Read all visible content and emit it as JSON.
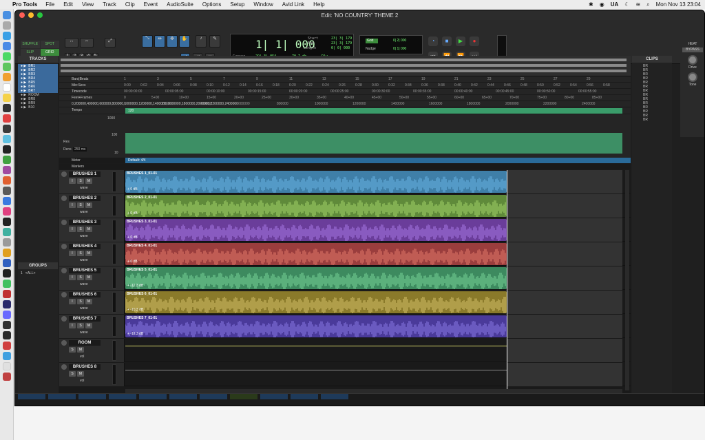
{
  "menubar": {
    "app_name": "Pro Tools",
    "items": [
      "File",
      "Edit",
      "View",
      "Track",
      "Clip",
      "Event",
      "AudioSuite",
      "Options",
      "Setup",
      "Window",
      "Avid Link",
      "Help"
    ],
    "right_text": "UA",
    "datetime": "Mon Nov 13  23:04"
  },
  "window": {
    "title": "Edit: 'NO COUNTRY' THEME 2"
  },
  "toolbar": {
    "modes": [
      "SHUFFLE",
      "SPOT",
      "SLIP",
      "GRID"
    ],
    "active_mode": "GRID",
    "zoom_presets": [
      "1",
      "2",
      "3",
      "4",
      "5"
    ]
  },
  "counter": {
    "main": "1| 1| 000",
    "start_label": "Start",
    "end_label": "End",
    "length_label": "Length",
    "start_value": "23| 3| 179",
    "end_value": "23| 3| 179",
    "length_value": "0| 0| 000",
    "cursor_label": "Cursor",
    "cursor_value": "29| 3| 054",
    "level_value": "-70.7 db",
    "dly_label": "Dly"
  },
  "grid": {
    "grid_label": "Grid",
    "grid_value": "0| 2| 000",
    "nudge_label": "Nudge",
    "nudge_value": "0| 1| 000"
  },
  "heat": {
    "title": "HEAT",
    "bypass": "BYPASS",
    "drive": "Drive",
    "tone": "Tone"
  },
  "tracks_panel": {
    "title": "TRACKS",
    "items": [
      "BR1",
      "BR2",
      "BR3",
      "BR4",
      "BR5",
      "BR6",
      "BR7",
      "ROOM",
      "BR8",
      "BR9",
      "B10"
    ]
  },
  "groups_panel": {
    "title": "GROUPS",
    "item": "<ALL>",
    "index": "1"
  },
  "clips_panel": {
    "title": "CLIPS",
    "items": [
      "BR",
      "BR",
      "BR",
      "BR",
      "BR",
      "BR",
      "BR",
      "BR",
      "BR",
      "BR",
      "BR",
      "BR",
      "BR",
      "BR"
    ]
  },
  "rulers": {
    "bars_beats": "Bars|Beats",
    "min_secs": "Min:Secs",
    "timecode": "Timecode",
    "feet_frames": "Feet+Frames",
    "samples": [
      "0",
      "200000",
      "400000",
      "600000",
      "800000",
      "1000000",
      "1200000",
      "1400000",
      "1600000",
      "1800000",
      "2000000",
      "2200000",
      "2400000"
    ],
    "tempo": "Tempo",
    "meter": "Meter",
    "markers": "Markers",
    "bars": [
      "1",
      "3",
      "5",
      "7",
      "9",
      "11",
      "13",
      "15",
      "17",
      "19",
      "21",
      "23",
      "25",
      "27",
      "29"
    ],
    "secs": [
      "0:00",
      "0:02",
      "0:04",
      "0:06",
      "0:08",
      "0:10",
      "0:12",
      "0:14",
      "0:16",
      "0:18",
      "0:20",
      "0:22",
      "0:24",
      "0:26",
      "0:28",
      "0:30",
      "0:32",
      "0:34",
      "0:36",
      "0:38",
      "0:40",
      "0:42",
      "0:44",
      "0:46",
      "0:48",
      "0:50",
      "0:52",
      "0:54",
      "0:56",
      "0:58"
    ],
    "timecodes": [
      "00:00:00:00",
      "00:00:05:00",
      "00:00:10:00",
      "00:00:15:00",
      "00:00:20:00",
      "00:00:25:00",
      "00:00:30:00",
      "00:00:35:00",
      "00:00:40:00",
      "00:00:45:00",
      "00:00:50:00",
      "00:00:55:00"
    ],
    "feet": [
      "0",
      "5+00",
      "10+00",
      "15+00",
      "20+00",
      "25+00",
      "30+00",
      "35+00",
      "40+00",
      "45+00",
      "50+00",
      "55+00",
      "60+00",
      "65+00",
      "70+00",
      "75+00",
      "80+00",
      "85+00"
    ],
    "tempo_value": "120",
    "tempo_scale": [
      "1000",
      "100",
      "10"
    ],
    "res_label": "Res",
    "dens_label": "Dens",
    "dens_value": "250 ms",
    "meter_value": "Default: 4/4"
  },
  "track_buttons": {
    "input": "I",
    "solo": "S",
    "mute": "M",
    "view": "wave",
    "vol": "vol"
  },
  "tracks": [
    {
      "name": "BRUSHES 1",
      "clip": "BRUSHES 1_01-01",
      "gain": "+ 0 dB",
      "color": "#3f7fa8",
      "wave": "#6ab4e6"
    },
    {
      "name": "BRUSHES 2",
      "clip": "BRUSHES 2_01-01",
      "gain": "+ 0 dB",
      "color": "#5f8a3a",
      "wave": "#a6d66a"
    },
    {
      "name": "BRUSHES 3",
      "clip": "BRUSHES 3_01-01",
      "gain": "+ 0 dB",
      "color": "#6a3d9a",
      "wave": "#a879e6"
    },
    {
      "name": "BRUSHES 4",
      "clip": "BRUSHES 4_01-01",
      "gain": "+ 0 dB",
      "color": "#9a3d3d",
      "wave": "#e67a6a"
    },
    {
      "name": "BRUSHES 5",
      "clip": "BRUSHES 5_01-01",
      "gain": "+ -12.3 dB",
      "color": "#3d8a5f",
      "wave": "#79d69a"
    },
    {
      "name": "BRUSHES 6",
      "clip": "BRUSHES 6_01-01",
      "gain": "+ -10.3 dB",
      "color": "#8a7a2a",
      "wave": "#d6c26a"
    },
    {
      "name": "BRUSHES 7",
      "clip": "BRUSHES 7_01-01",
      "gain": "+ -12.3 dB",
      "color": "#4a3a9a",
      "wave": "#8a79e6"
    },
    {
      "name": "ROOM",
      "clip": "",
      "gain": "",
      "color": "#2e2e2e",
      "wave": "#d6d66a"
    },
    {
      "name": "BRUSHES 8",
      "clip": "",
      "gain": "",
      "color": "#2e2e2e",
      "wave": "#888"
    }
  ]
}
